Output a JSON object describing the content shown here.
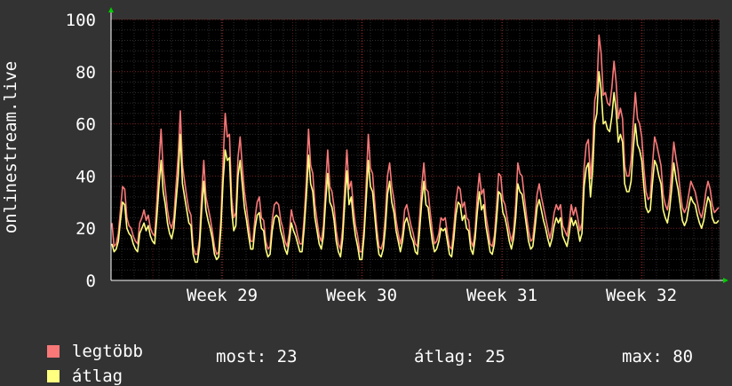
{
  "chart_data": {
    "type": "line",
    "ylabel": "onlinestream.live",
    "ylim": [
      0,
      100
    ],
    "yticks": [
      0,
      20,
      40,
      60,
      80,
      100
    ],
    "x_tick_labels": [
      "Week 29",
      "Week 30",
      "Week 31",
      "Week 32"
    ],
    "grid": true,
    "legend_placement": "bottom-left",
    "series": [
      {
        "name": "legtöbb",
        "color": "#f87878",
        "values": [
          22,
          13,
          14,
          18,
          27,
          36,
          35,
          24,
          21,
          20,
          17,
          15,
          14,
          22,
          24,
          27,
          23,
          25,
          20,
          18,
          17,
          30,
          44,
          58,
          42,
          35,
          27,
          22,
          20,
          24,
          36,
          48,
          65,
          44,
          38,
          32,
          27,
          25,
          13,
          10,
          10,
          16,
          33,
          46,
          32,
          28,
          24,
          19,
          13,
          10,
          11,
          24,
          45,
          64,
          55,
          56,
          32,
          24,
          26,
          47,
          55,
          44,
          34,
          28,
          21,
          15,
          15,
          24,
          30,
          32,
          24,
          23,
          15,
          12,
          13,
          23,
          29,
          30,
          29,
          23,
          20,
          15,
          13,
          18,
          27,
          23,
          21,
          17,
          14,
          14,
          24,
          38,
          58,
          44,
          41,
          29,
          23,
          17,
          15,
          21,
          36,
          50,
          36,
          34,
          28,
          19,
          14,
          12,
          20,
          36,
          50,
          35,
          38,
          28,
          21,
          17,
          11,
          11,
          20,
          37,
          56,
          43,
          41,
          30,
          20,
          13,
          12,
          15,
          25,
          40,
          45,
          36,
          31,
          23,
          18,
          14,
          18,
          27,
          29,
          25,
          21,
          18,
          14,
          13,
          24,
          36,
          45,
          35,
          34,
          26,
          19,
          14,
          15,
          18,
          24,
          23,
          24,
          18,
          13,
          12,
          20,
          30,
          36,
          35,
          28,
          30,
          24,
          23,
          15,
          13,
          19,
          32,
          41,
          33,
          35,
          25,
          20,
          14,
          13,
          17,
          28,
          41,
          40,
          31,
          29,
          24,
          19,
          15,
          19,
          29,
          45,
          41,
          40,
          32,
          25,
          19,
          15,
          16,
          24,
          33,
          37,
          32,
          28,
          24,
          20,
          16,
          20,
          26,
          29,
          27,
          29,
          21,
          19,
          17,
          22,
          29,
          25,
          28,
          24,
          19,
          22,
          43,
          52,
          54,
          39,
          50,
          69,
          73,
          94,
          87,
          71,
          72,
          68,
          67,
          74,
          84,
          76,
          62,
          66,
          62,
          44,
          40,
          40,
          46,
          60,
          72,
          62,
          60,
          55,
          43,
          34,
          31,
          32,
          44,
          55,
          52,
          48,
          44,
          33,
          29,
          27,
          32,
          42,
          53,
          47,
          42,
          34,
          28,
          26,
          28,
          33,
          38,
          36,
          34,
          30,
          26,
          24,
          28,
          34,
          38,
          35,
          29,
          26,
          27,
          28
        ]
      },
      {
        "name": "átlag",
        "color": "#ffff80",
        "values": [
          14,
          11,
          12,
          15,
          23,
          30,
          29,
          20,
          18,
          17,
          14,
          12,
          11,
          18,
          20,
          22,
          19,
          21,
          17,
          15,
          14,
          24,
          36,
          46,
          34,
          29,
          22,
          18,
          16,
          20,
          30,
          40,
          56,
          37,
          32,
          27,
          22,
          21,
          10,
          7,
          7,
          13,
          27,
          38,
          27,
          23,
          20,
          16,
          10,
          8,
          9,
          20,
          38,
          50,
          46,
          47,
          27,
          19,
          21,
          40,
          46,
          37,
          28,
          23,
          17,
          12,
          12,
          20,
          25,
          26,
          20,
          19,
          12,
          9,
          10,
          19,
          24,
          25,
          24,
          19,
          16,
          12,
          10,
          15,
          22,
          19,
          17,
          14,
          11,
          11,
          20,
          32,
          48,
          37,
          34,
          24,
          19,
          14,
          12,
          17,
          30,
          41,
          30,
          28,
          23,
          15,
          11,
          9,
          16,
          30,
          42,
          29,
          32,
          23,
          17,
          13,
          8,
          8,
          17,
          31,
          46,
          36,
          34,
          25,
          16,
          10,
          9,
          12,
          20,
          33,
          38,
          30,
          26,
          19,
          15,
          11,
          15,
          22,
          24,
          21,
          17,
          15,
          11,
          10,
          19,
          30,
          38,
          29,
          28,
          21,
          15,
          11,
          12,
          15,
          20,
          19,
          20,
          15,
          10,
          9,
          16,
          25,
          30,
          29,
          23,
          25,
          20,
          19,
          12,
          10,
          16,
          26,
          34,
          27,
          29,
          21,
          16,
          11,
          10,
          14,
          23,
          34,
          33,
          26,
          24,
          20,
          15,
          12,
          16,
          24,
          37,
          34,
          33,
          27,
          21,
          15,
          12,
          13,
          20,
          28,
          31,
          27,
          23,
          20,
          16,
          13,
          16,
          21,
          24,
          22,
          24,
          17,
          15,
          13,
          18,
          24,
          21,
          23,
          20,
          15,
          18,
          36,
          43,
          45,
          32,
          42,
          60,
          64,
          80,
          73,
          60,
          61,
          58,
          57,
          63,
          72,
          65,
          53,
          56,
          53,
          37,
          34,
          34,
          38,
          50,
          60,
          52,
          50,
          46,
          36,
          28,
          26,
          27,
          37,
          46,
          44,
          40,
          37,
          27,
          24,
          22,
          27,
          35,
          45,
          39,
          35,
          29,
          23,
          21,
          23,
          28,
          32,
          30,
          29,
          25,
          22,
          20,
          23,
          28,
          32,
          30,
          24,
          22,
          22,
          23
        ]
      }
    ]
  },
  "legend": {
    "items": [
      {
        "label": "legtöbb",
        "color": "#f87878"
      },
      {
        "label": "átlag",
        "color": "#ffff80"
      }
    ]
  },
  "stats": {
    "now": "most: 23",
    "avg": "átlag: 25",
    "max": "max: 80"
  }
}
